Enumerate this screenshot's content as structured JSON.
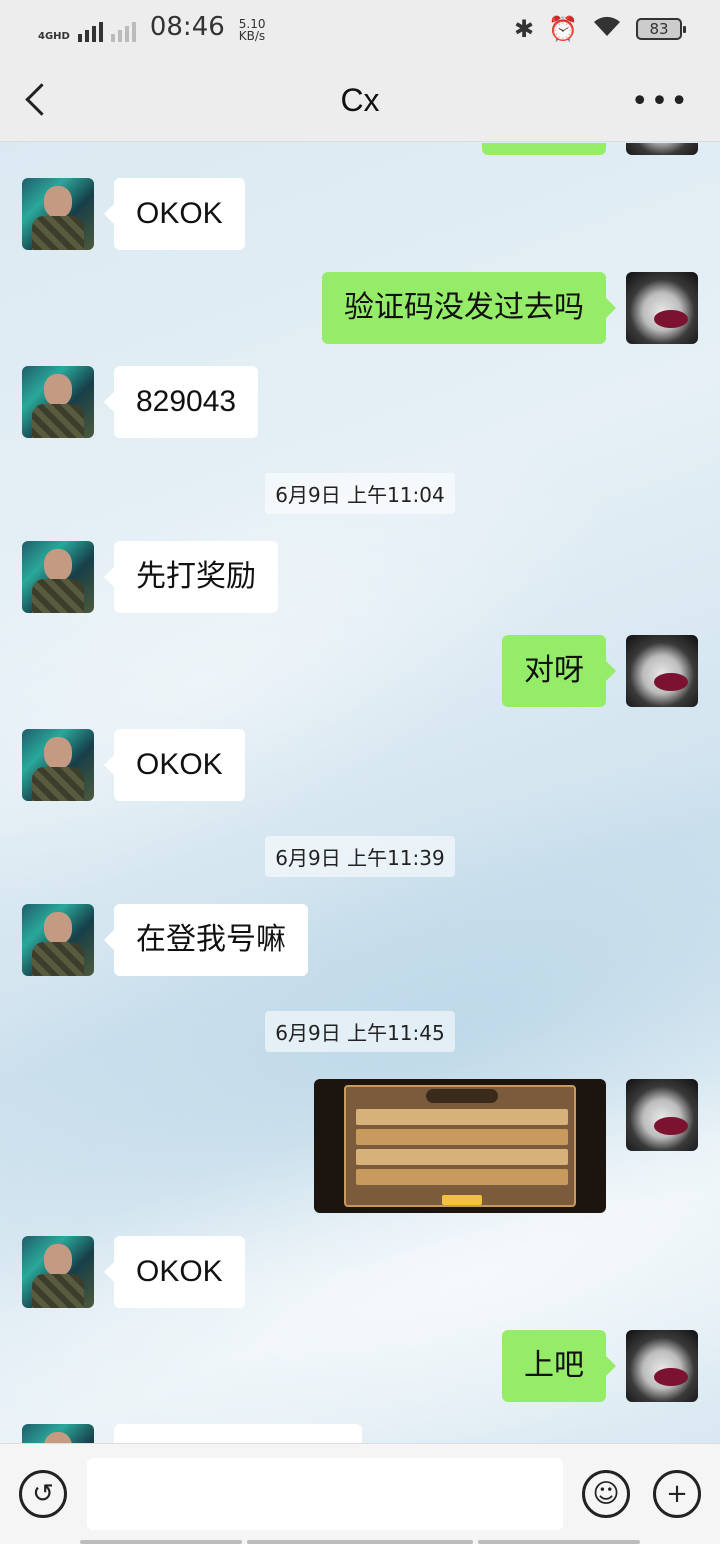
{
  "status_bar": {
    "network": "4GHD",
    "time": "08:46",
    "speed_value": "5.10",
    "speed_unit": "KB/s",
    "icons": [
      "bluetooth-icon",
      "alarm-icon",
      "wifi-icon"
    ],
    "battery": "83"
  },
  "nav": {
    "title": "Cx",
    "back_icon": "chevron-left-icon",
    "more_icon": "more-icon",
    "more_label": "•••"
  },
  "messages": [
    {
      "side": "left",
      "text": "OKOK"
    },
    {
      "side": "right",
      "text": "验证码没发过去吗"
    },
    {
      "side": "left",
      "text": "829043"
    },
    {
      "time": "6月9日 上午11:04"
    },
    {
      "side": "left",
      "text": "先打奖励"
    },
    {
      "side": "right",
      "text": "对呀"
    },
    {
      "side": "left",
      "text": "OKOK"
    },
    {
      "time": "6月9日 上午11:39"
    },
    {
      "side": "left",
      "text": "在登我号嘛"
    },
    {
      "time": "6月9日 上午11:45"
    },
    {
      "side": "right",
      "image": "game-screenshot"
    },
    {
      "side": "left",
      "text": "OKOK"
    },
    {
      "side": "right",
      "text": "上吧"
    }
  ],
  "input": {
    "voice_icon": "voice-icon",
    "voice_glyph": "↺",
    "emoji_icon": "emoji-icon",
    "emoji_glyph": "☺",
    "plus_icon": "plus-icon",
    "plus_glyph": "+",
    "value": ""
  },
  "colors": {
    "sent_bubble": "#95ec69",
    "received_bubble": "#ffffff",
    "bar_background": "#ededed"
  }
}
